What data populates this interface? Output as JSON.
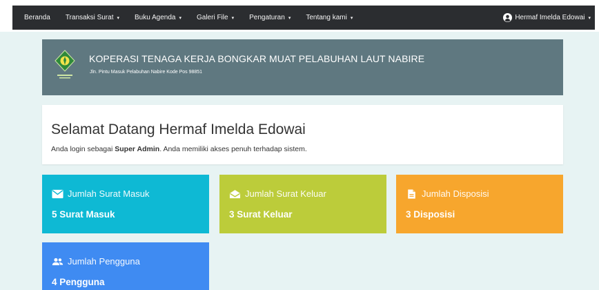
{
  "navbar": {
    "items": [
      {
        "label": "Beranda",
        "dropdown": false
      },
      {
        "label": "Transaksi Surat",
        "dropdown": true
      },
      {
        "label": "Buku Agenda",
        "dropdown": true
      },
      {
        "label": "Galeri File",
        "dropdown": true
      },
      {
        "label": "Pengaturan",
        "dropdown": true
      },
      {
        "label": "Tentang kami",
        "dropdown": true
      }
    ],
    "caret": "▾",
    "user": {
      "name": "Hermaf Imelda Edowai",
      "caret": "▾",
      "icon": "user-circle-icon"
    }
  },
  "header": {
    "title": "KOPERASI TENAGA KERJA BONGKAR MUAT PELABUHAN LAUT NABIRE",
    "address": "Jln. Pintu Masuk Pelabuhan Nabire Kode Pos 98851",
    "logo": "koperasi-logo"
  },
  "welcome": {
    "title": "Selamat Datang Hermaf Imelda Edowai",
    "text_before": "Anda login sebagai ",
    "role": "Super Admin",
    "text_after": ". Anda memiliki akses penuh terhadap sistem."
  },
  "cards": [
    {
      "title": "Jumlah Surat Masuk",
      "value": "5 Surat Masuk",
      "icon": "envelope-icon",
      "color": "#0eb9d4"
    },
    {
      "title": "Jumlah Surat Keluar",
      "value": "3 Surat Keluar",
      "icon": "envelope-open-icon",
      "color": "#bccc3a"
    },
    {
      "title": "Jumlah Disposisi",
      "value": "3 Disposisi",
      "icon": "document-icon",
      "color": "#f7a62d"
    },
    {
      "title": "Jumlah Pengguna",
      "value": "4 Pengguna",
      "icon": "users-icon",
      "color": "#3f8bf2"
    }
  ],
  "colors": {
    "navbar_bg": "#2b2d30",
    "header_bg": "#5f7880",
    "page_bg": "#e7f3f3"
  }
}
